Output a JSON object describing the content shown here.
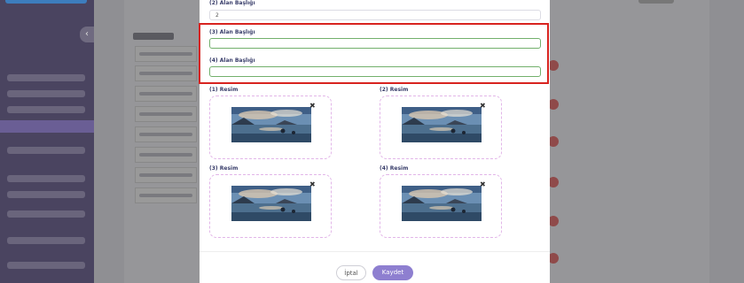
{
  "modal": {
    "field2": {
      "label": "(2) Alan Başlığı",
      "value": "2"
    },
    "field3": {
      "label": "(3) Alan Başlığı",
      "value": ""
    },
    "field4": {
      "label": "(4) Alan Başlığı",
      "value": ""
    },
    "images": [
      {
        "label": "(1) Resim"
      },
      {
        "label": "(2) Resim"
      },
      {
        "label": "(3) Resim"
      },
      {
        "label": "(4) Resim"
      }
    ],
    "close_glyph": "✖",
    "cancel_label": "İptal",
    "save_label": "Kaydet"
  },
  "colors": {
    "primary": "#8e7fd0",
    "highlight": "#d8231f",
    "input_border_valid": "#72b06c",
    "label_text": "#3a3f6b",
    "dashed_border": "#e2b6e8"
  }
}
